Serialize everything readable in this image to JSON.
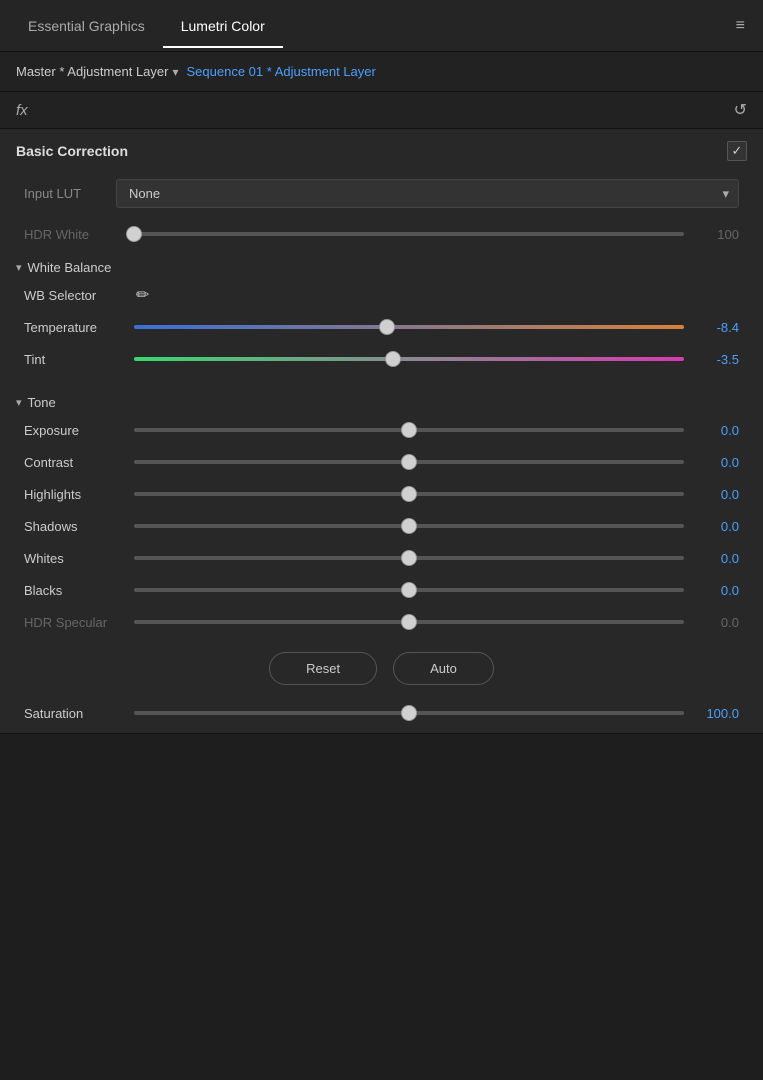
{
  "tabs": {
    "essential_graphics": "Essential Graphics",
    "lumetri_color": "Lumetri Color",
    "menu_icon": "≡"
  },
  "layer": {
    "name": "Master * Adjustment Layer",
    "chevron": "▾",
    "sequence_link": "Sequence 01 * Adjustment Layer"
  },
  "fx_row": {
    "fx_label": "fx",
    "reset_icon": "↺"
  },
  "basic_correction": {
    "title": "Basic Correction",
    "enabled": true,
    "input_lut": {
      "label": "Input LUT",
      "value": "None"
    },
    "hdr_white": {
      "label": "HDR White",
      "value": 100,
      "thumb_position": "0%"
    },
    "white_balance": {
      "title": "White Balance",
      "wb_selector": {
        "label": "WB Selector"
      },
      "temperature": {
        "label": "Temperature",
        "value": "-8.4",
        "thumb_position": "46%"
      },
      "tint": {
        "label": "Tint",
        "value": "-3.5",
        "thumb_position": "47%"
      }
    },
    "tone": {
      "title": "Tone",
      "exposure": {
        "label": "Exposure",
        "value": "0.0",
        "thumb_position": "50%"
      },
      "contrast": {
        "label": "Contrast",
        "value": "0.0",
        "thumb_position": "50%"
      },
      "highlights": {
        "label": "Highlights",
        "value": "0.0",
        "thumb_position": "50%"
      },
      "shadows": {
        "label": "Shadows",
        "value": "0.0",
        "thumb_position": "50%"
      },
      "whites": {
        "label": "Whites",
        "value": "0.0",
        "thumb_position": "50%"
      },
      "blacks": {
        "label": "Blacks",
        "value": "0.0",
        "thumb_position": "50%"
      },
      "hdr_specular": {
        "label": "HDR Specular",
        "value": "0.0",
        "thumb_position": "50%",
        "dim": true
      },
      "reset_button": "Reset",
      "auto_button": "Auto"
    },
    "saturation": {
      "label": "Saturation",
      "value": "100.0",
      "thumb_position": "50%"
    }
  }
}
